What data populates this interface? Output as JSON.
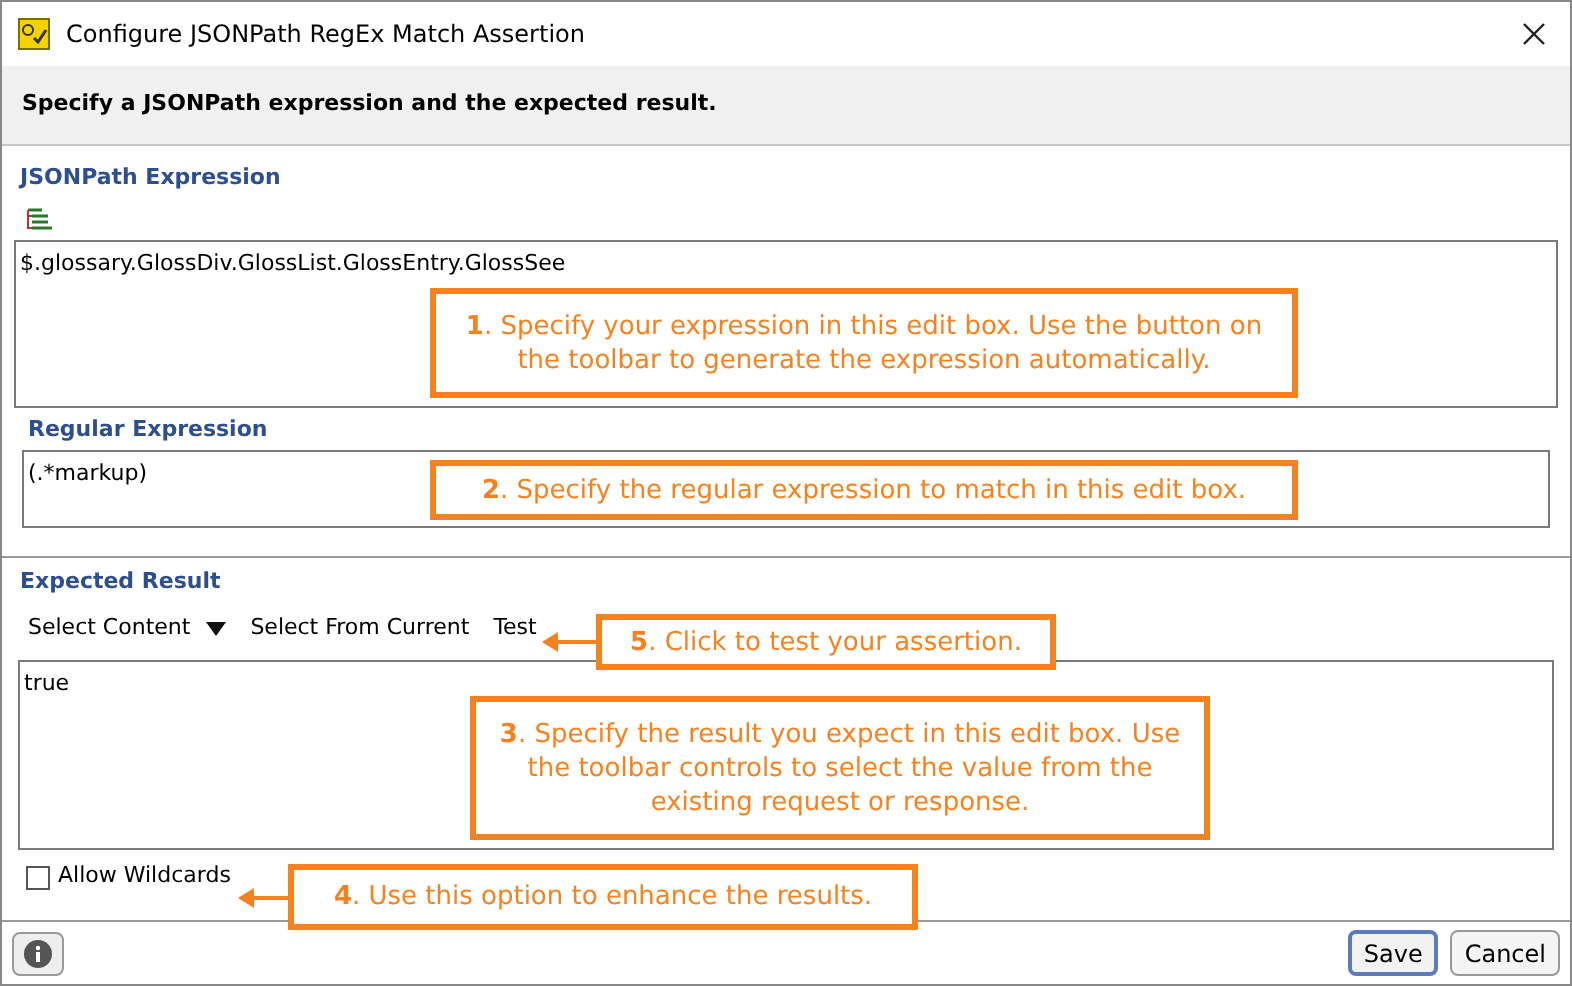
{
  "window": {
    "title": "Configure JSONPath RegEx Match Assertion"
  },
  "header": "Specify a JSONPath expression and the expected result.",
  "jsonpath": {
    "label": "JSONPath Expression",
    "value": "$.glossary.GlossDiv.GlossList.GlossEntry.GlossSee"
  },
  "regex": {
    "label": "Regular Expression",
    "value": "(.*markup)"
  },
  "expected": {
    "label": "Expected Result",
    "toolbar": [
      "Select Content",
      "Select From Current",
      "Test"
    ],
    "value": "true"
  },
  "allow_wildcards": {
    "label": "Allow Wildcards",
    "checked": false
  },
  "buttons": [
    "Save",
    "Cancel"
  ],
  "callouts": [
    {
      "text": "**1**. Specify your expression in this edit box. Use the button on the toolbar to generate the expression automatically.",
      "arrow": false
    },
    {
      "text": "**2**. Specify the regular expression to match in this edit box.",
      "arrow": false
    },
    {
      "text": "**5**. Click to test your assertion.",
      "arrow": true
    },
    {
      "text": "**3**. Specify the result you expect in this edit box. Use the toolbar controls to select the value from the existing request or response.",
      "arrow": false
    },
    {
      "text": "**4**. Use this option to enhance the results.",
      "arrow": true
    }
  ]
}
